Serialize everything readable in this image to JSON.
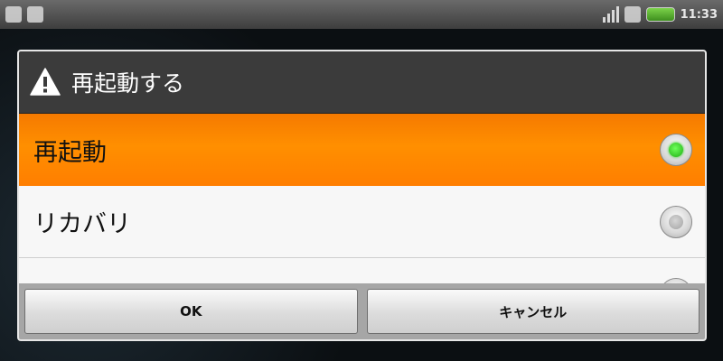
{
  "status_bar": {
    "clock": "11:33"
  },
  "dialog": {
    "title": "再起動する",
    "title_icon": "warning-icon",
    "options": [
      {
        "label": "再起動",
        "selected": true
      },
      {
        "label": "リカバリ",
        "selected": false
      }
    ],
    "buttons": {
      "ok": "OK",
      "cancel": "キャンセル"
    }
  },
  "colors": {
    "selected_row": "#ff8a00",
    "radio_on": "#2cc81a",
    "header": "#3b3b3b"
  }
}
